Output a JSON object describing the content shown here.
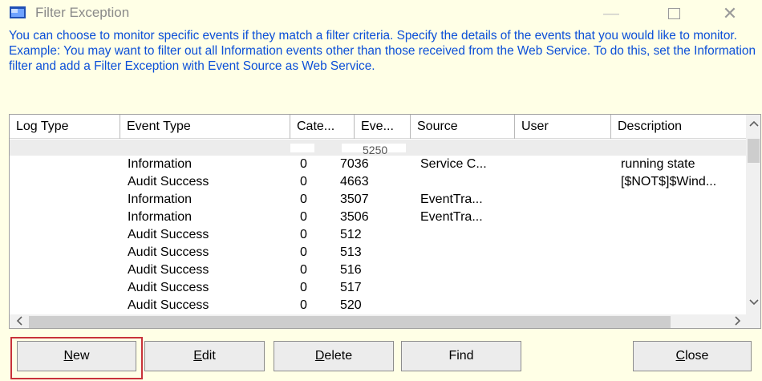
{
  "window": {
    "title": "Filter Exception",
    "controls": {
      "minimize": "—",
      "maximize": "",
      "close": "✕"
    }
  },
  "description": "You can choose to monitor specific events if they match a filter criteria. Specify the details of the events that you would like to monitor.\nExample: You may want to filter out all Information events other than those received from the Web Service. To do this, set the Information filter and add a Filter Exception with Event Source as Web Service.",
  "table": {
    "columns": [
      "Log Type",
      "Event Type",
      "Cate...",
      "Eve...",
      "Source",
      "User",
      "Description"
    ],
    "partial_row_text": "5250",
    "rows": [
      {
        "log_type": "",
        "event_type": "Information",
        "category": "0",
        "event_id": "7036",
        "source": "Service C...",
        "user": "",
        "description": "running state"
      },
      {
        "log_type": "",
        "event_type": "Audit Success",
        "category": "0",
        "event_id": "4663",
        "source": "",
        "user": "",
        "description": "[$NOT$]$Wind..."
      },
      {
        "log_type": "",
        "event_type": "Information",
        "category": "0",
        "event_id": "3507",
        "source": "EventTra...",
        "user": "",
        "description": ""
      },
      {
        "log_type": "",
        "event_type": "Information",
        "category": "0",
        "event_id": "3506",
        "source": "EventTra...",
        "user": "",
        "description": ""
      },
      {
        "log_type": "",
        "event_type": "Audit Success",
        "category": "0",
        "event_id": "512",
        "source": "",
        "user": "",
        "description": ""
      },
      {
        "log_type": "",
        "event_type": "Audit Success",
        "category": "0",
        "event_id": "513",
        "source": "",
        "user": "",
        "description": ""
      },
      {
        "log_type": "",
        "event_type": "Audit Success",
        "category": "0",
        "event_id": "516",
        "source": "",
        "user": "",
        "description": ""
      },
      {
        "log_type": "",
        "event_type": "Audit Success",
        "category": "0",
        "event_id": "517",
        "source": "",
        "user": "",
        "description": ""
      },
      {
        "log_type": "",
        "event_type": "Audit Success",
        "category": "0",
        "event_id": "520",
        "source": "",
        "user": "",
        "description": ""
      }
    ]
  },
  "scrollbars": {
    "up": "^",
    "down": "v",
    "left": "<",
    "right": ">"
  },
  "buttons": {
    "new": {
      "mnemonic": "N",
      "rest": "ew"
    },
    "edit": {
      "mnemonic": "E",
      "rest": "dit"
    },
    "delete": {
      "mnemonic": "D",
      "rest": "elete"
    },
    "find": {
      "label": "Find"
    },
    "close": {
      "mnemonic": "C",
      "rest": "lose"
    }
  },
  "colors": {
    "background": "#ffffe6",
    "description_text": "#0b4fd8",
    "highlight_border": "#c8323a"
  },
  "icons": [
    "app-window-icon",
    "minimize-icon",
    "maximize-icon",
    "close-icon",
    "scroll-up-icon",
    "scroll-down-icon",
    "scroll-left-icon",
    "scroll-right-icon"
  ]
}
